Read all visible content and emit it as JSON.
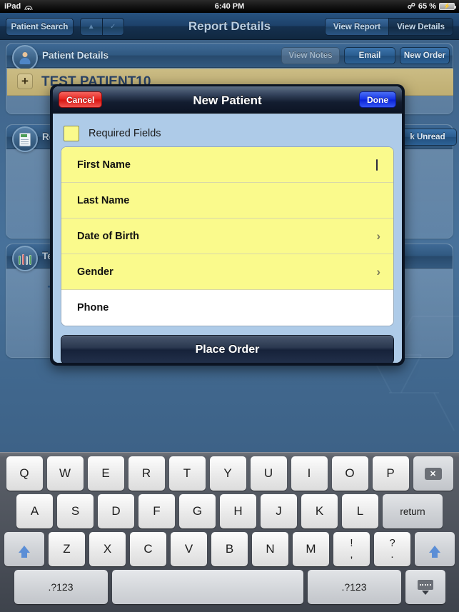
{
  "status_bar": {
    "device": "iPad",
    "wifi_icon": "wifi-icon",
    "time": "6:40 PM",
    "bluetooth_icon": "bluetooth-icon",
    "battery_percent": "65 %",
    "battery_icon": "battery-charging-icon"
  },
  "toolbar": {
    "patient_search": "Patient Search",
    "nav_up": "▲",
    "nav_down": "✓",
    "title": "Report Details",
    "segment_left": "View Report",
    "segment_right": "View Details",
    "selected_segment": "View Details"
  },
  "background": {
    "patient_panel": {
      "title": "Patient Details",
      "icon": "patient-avatar-icon",
      "buttons": [
        {
          "label": "View Notes",
          "disabled": true
        },
        {
          "label": "Email",
          "disabled": false
        },
        {
          "label": "New Order",
          "disabled": false
        }
      ],
      "patient_name": "TEST PATIENT10",
      "add_tile": "+"
    },
    "reports_panel": {
      "title": "Re",
      "icon": "report-document-icon",
      "mark_unread": "k Unread"
    },
    "tests_panel": {
      "title": "Te",
      "icon": "test-tubes-icon",
      "add_tile": "+"
    }
  },
  "modal": {
    "cancel_label": "Cancel",
    "title": "New Patient",
    "done_label": "Done",
    "legend_label": "Required Fields",
    "legend_color": "#fafa8c",
    "fields": [
      {
        "label": "First Name",
        "required": true,
        "accessory": "caret"
      },
      {
        "label": "Last Name",
        "required": true,
        "accessory": "none"
      },
      {
        "label": "Date of Birth",
        "required": true,
        "accessory": "chevron"
      },
      {
        "label": "Gender",
        "required": true,
        "accessory": "chevron"
      },
      {
        "label": "Phone",
        "required": false,
        "accessory": "none"
      }
    ],
    "place_order_label": "Place Order"
  },
  "keyboard": {
    "row1": [
      "Q",
      "W",
      "E",
      "R",
      "T",
      "Y",
      "U",
      "I",
      "O",
      "P"
    ],
    "delete_label": "×",
    "row2": [
      "A",
      "S",
      "D",
      "F",
      "G",
      "H",
      "J",
      "K",
      "L"
    ],
    "return_label": "return",
    "row3": [
      "Z",
      "X",
      "C",
      "V",
      "B",
      "N",
      "M"
    ],
    "punct1_top": "!",
    "punct1_bottom": ",",
    "punct2_top": "?",
    "punct2_bottom": ".",
    "shift_label": "shift-icon",
    "num_left": ".?123",
    "space_label": "",
    "num_right": ".?123",
    "hide_keyboard": "hide-keyboard-icon"
  }
}
